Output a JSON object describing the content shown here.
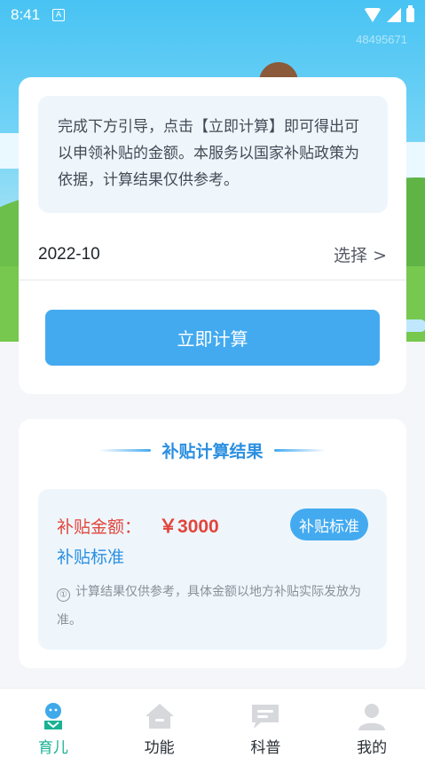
{
  "status_bar": {
    "time": "8:41",
    "indicator": "A"
  },
  "watermark": "48495671",
  "guide": {
    "text": "完成下方引导，点击【立即计算】即可得出可以申领补贴的金额。本服务以国家补贴政策为依据，计算结果仅供参考。"
  },
  "date_picker": {
    "value": "2022-10",
    "select_label": "选择 >"
  },
  "calc_button": "立即计算",
  "result": {
    "title": "补贴计算结果",
    "amount_label": "补贴金额：",
    "amount_value": "￥3000",
    "standard_link": "补贴标准",
    "standard_button": "补贴标准",
    "note_icon": "①",
    "note": "计算结果仅供参考，具体金额以地方补贴实际发放为准。"
  },
  "bottom_nav": {
    "items": [
      {
        "label": "育儿",
        "icon": "baby-icon",
        "active": true
      },
      {
        "label": "功能",
        "icon": "home-icon",
        "active": false
      },
      {
        "label": "科普",
        "icon": "chat-icon",
        "active": false
      },
      {
        "label": "我的",
        "icon": "user-icon",
        "active": false
      }
    ]
  },
  "colors": {
    "accent": "#43aaf0",
    "amount": "#e2453c",
    "nav_active": "#19b394"
  }
}
